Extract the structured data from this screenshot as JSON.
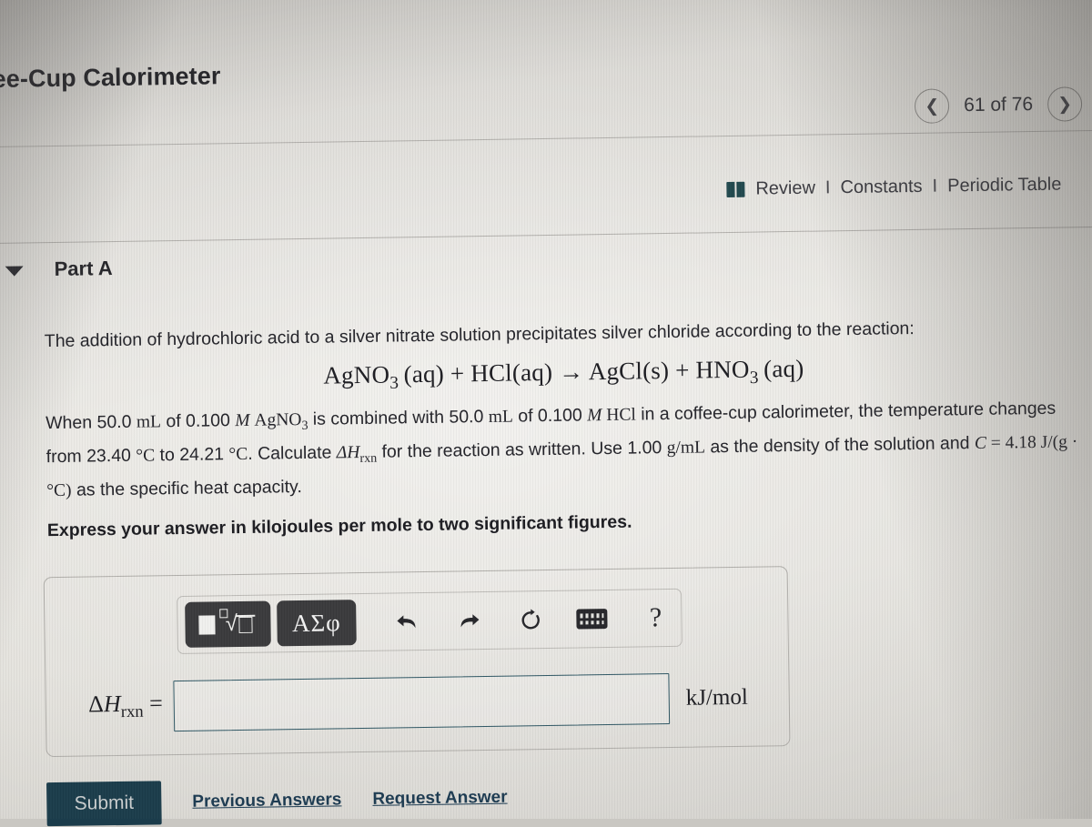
{
  "header": {
    "title": "fee-Cup Calorimeter",
    "pager": {
      "prev_icon": "chevron-left-icon",
      "label": "61 of 76",
      "next_icon": "chevron-right-icon"
    },
    "resources": {
      "book_icon": "book-icon",
      "review": "Review",
      "separator": "I",
      "constants": "Constants",
      "periodic_table": "Periodic Table"
    }
  },
  "part": {
    "caret_icon": "caret-down-icon",
    "label": "Part A"
  },
  "question": {
    "intro": "The addition of hydrochloric acid to a silver nitrate solution precipitates silver chloride according to the reaction:",
    "equation": "AgNO3 (aq) + HCl(aq) → AgCl(s) + HNO3 (aq)",
    "equation_parts": {
      "reactant_1": "AgNO3 (aq)",
      "plus_1": "+",
      "reactant_2": "HCl(aq)",
      "arrow": "→",
      "product_1": "AgCl(s)",
      "plus_2": "+",
      "product_2": "HNO3 (aq)"
    },
    "body_line_1_a": "When 50.0 ",
    "body_volume_1": "mL",
    "body_line_1_b": " of 0.100 ",
    "body_molarity_1": "M",
    "body_species_1": "AgNO",
    "body_species_1_sub": "3",
    "body_line_1_c": " is combined with 50.0 ",
    "body_volume_2": "mL",
    "body_line_1_d": " of 0.100 ",
    "body_molarity_2": "M",
    "body_species_2": "HCl",
    "body_line_1_e": " in a coffee-cup calorimeter, the temperature changes from 23.40 ",
    "temp_1": "°C",
    "body_line_1_f": " to 24.21 ",
    "temp_2": "°C",
    "body_line_1_g": ". Calculate ",
    "delta_h": "ΔH",
    "delta_h_sub": "rxn",
    "body_line_1_h": " for the reaction as written. Use 1.00 ",
    "density_units": "g/mL",
    "body_line_1_i": " as the density of the solution and ",
    "c_symbol": "C",
    "c_value": " = 4.18 J/(g · °C)",
    "body_line_1_j": " as the specific heat capacity.",
    "instruction": "Express your answer in kilojoules per mole to two significant figures."
  },
  "answer": {
    "toolbar": {
      "template_button": "math-template-button",
      "greek_button": "ΑΣφ",
      "undo_icon": "undo-arrow-icon",
      "undo_glyph": "↰",
      "redo_icon": "redo-arrow-icon",
      "redo_glyph": "↱",
      "reset_icon": "reset-circular-arrow-icon",
      "reset_glyph": "↻",
      "keyboard_icon": "keyboard-icon",
      "help_icon": "help-question-mark-icon",
      "help_glyph": "?"
    },
    "label_symbol": "ΔH",
    "label_sub": "rxn",
    "label_equals": " =",
    "value": "",
    "placeholder": "",
    "units": "kJ/mol"
  },
  "footer": {
    "submit_label": "Submit",
    "previous_answers_label": "Previous Answers",
    "request_answer_label": "Request Answer"
  },
  "colors": {
    "submit_bg": "#1b3c4b",
    "link": "#1d3b52",
    "book_icon": "#21484e",
    "input_border": "#2f5764",
    "toolbar_dark": "#3a3a3c"
  }
}
